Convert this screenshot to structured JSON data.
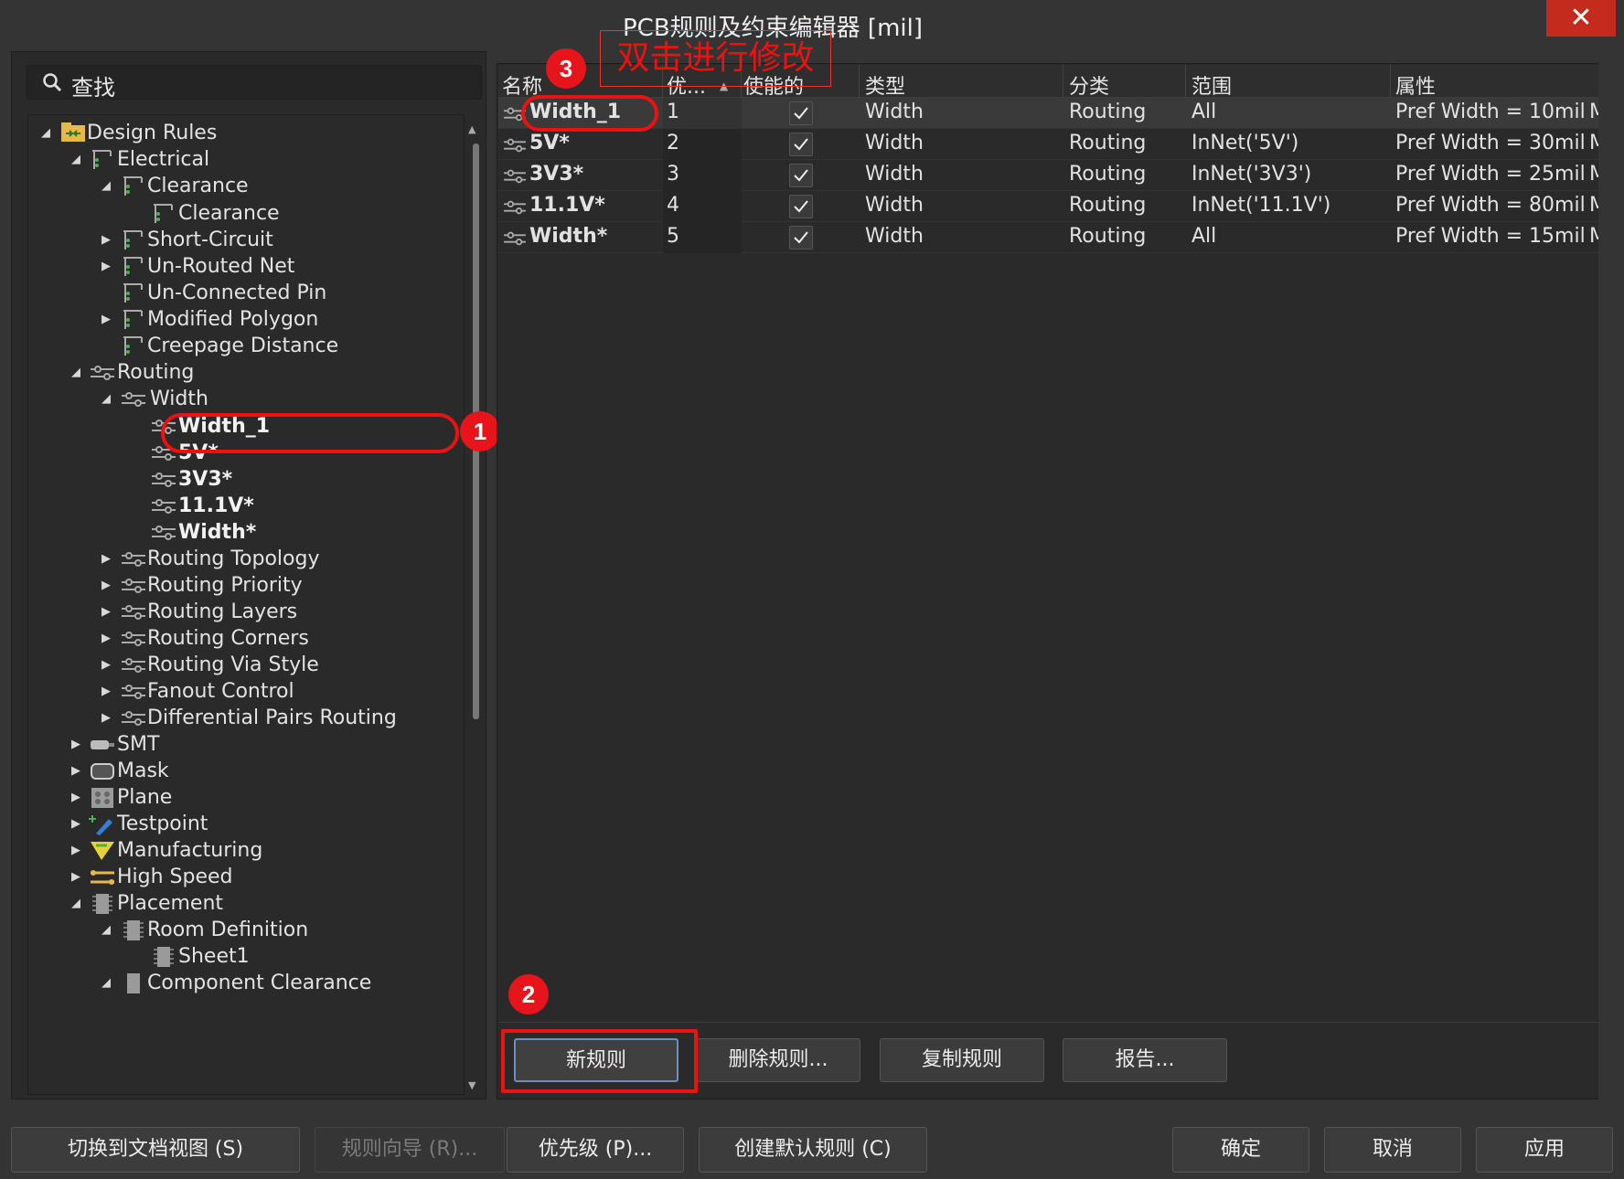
{
  "window": {
    "title": "PCB规则及约束编辑器 [mil]",
    "close_glyph": "✕"
  },
  "search": {
    "placeholder": "查找"
  },
  "tree": {
    "design_rules": "Design Rules",
    "electrical": "Electrical",
    "clearance": "Clearance",
    "clearance_child": "Clearance",
    "short_circuit": "Short-Circuit",
    "unrouted_net": "Un-Routed Net",
    "unconnected_pin": "Un-Connected Pin",
    "modified_polygon": "Modified Polygon",
    "creepage_distance": "Creepage Distance",
    "routing": "Routing",
    "width": "Width",
    "width_children": [
      "Width_1",
      "5V*",
      "3V3*",
      "11.1V*",
      "Width*"
    ],
    "routing_topology": "Routing Topology",
    "routing_priority": "Routing Priority",
    "routing_layers": "Routing Layers",
    "routing_corners": "Routing Corners",
    "routing_via_style": "Routing Via Style",
    "fanout_control": "Fanout Control",
    "diff_pairs_routing": "Differential Pairs Routing",
    "smt": "SMT",
    "mask": "Mask",
    "plane": "Plane",
    "testpoint": "Testpoint",
    "manufacturing": "Manufacturing",
    "high_speed": "High Speed",
    "placement": "Placement",
    "room_definition": "Room Definition",
    "sheet1": "Sheet1",
    "component_clearance": "Component Clearance"
  },
  "grid": {
    "headers": {
      "name": "名称",
      "priority": "优...",
      "enabled": "使能的",
      "type": "类型",
      "category": "分类",
      "scope": "范围",
      "attributes": "属性",
      "overflow": "M"
    },
    "rows": [
      {
        "name": "Width_1",
        "priority": "1",
        "enabled": true,
        "type": "Width",
        "category": "Routing",
        "scope": "All",
        "attributes": "Pref Width = 10mil"
      },
      {
        "name": "5V*",
        "priority": "2",
        "enabled": true,
        "type": "Width",
        "category": "Routing",
        "scope": "InNet('5V')",
        "attributes": "Pref Width = 30mil"
      },
      {
        "name": "3V3*",
        "priority": "3",
        "enabled": true,
        "type": "Width",
        "category": "Routing",
        "scope": "InNet('3V3')",
        "attributes": "Pref Width = 25mil"
      },
      {
        "name": "11.1V*",
        "priority": "4",
        "enabled": true,
        "type": "Width",
        "category": "Routing",
        "scope": "InNet('11.1V')",
        "attributes": "Pref Width = 80mil"
      },
      {
        "name": "Width*",
        "priority": "5",
        "enabled": true,
        "type": "Width",
        "category": "Routing",
        "scope": "All",
        "attributes": "Pref Width = 15mil"
      }
    ]
  },
  "right_buttons": {
    "new_rule": "新规则",
    "delete_rule": "删除规则...",
    "duplicate_rule": "复制规则",
    "report": "报告..."
  },
  "bottom_buttons": {
    "doc_view": "切换到文档视图 (S)",
    "rule_wizard": "规则向导 (R)...",
    "priorities": "优先级 (P)...",
    "create_default": "创建默认规则 (C)",
    "ok": "确定",
    "cancel": "取消",
    "apply": "应用"
  },
  "annotations": {
    "step1": "1",
    "step2": "2",
    "step3": "3",
    "note": "双击进行修改"
  },
  "colors": {
    "background": "#343434",
    "panel": "#2a2a2a",
    "accent_red": "#e8141b",
    "close_red": "#c42b1c"
  }
}
